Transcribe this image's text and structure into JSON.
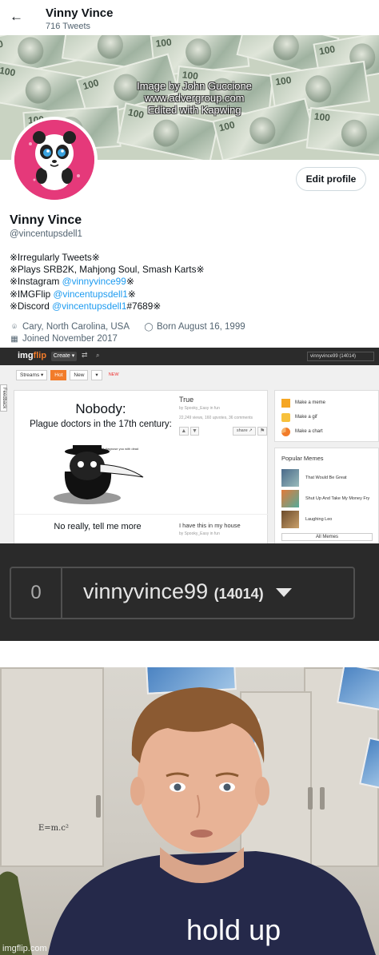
{
  "twitter": {
    "header_name": "Vinny Vince",
    "tweet_count": "716 Tweets",
    "banner_credit": [
      "Image by John Guccione",
      "www.advergroup.com",
      "Edited with Kapwing"
    ],
    "bill_denom": "100",
    "edit_profile_label": "Edit profile",
    "name": "Vinny Vince",
    "handle": "@vincentupsdell1",
    "bio": {
      "line1": "※Irregularly Tweets※",
      "line2": "※Plays SRB2K, Mahjong Soul, Smash Karts※",
      "line3_prefix": "※Instagram ",
      "line3_link": "@vinnyvince99",
      "line3_suffix": "※",
      "line4_prefix": "※IMGFlip ",
      "line4_link": "@vincentupsdell1",
      "line4_suffix": "※",
      "line5_prefix": "※Discord ",
      "line5_link": "@vincentupsdell1",
      "line5_suffix": "#7689※"
    },
    "location": "Cary, North Carolina, USA",
    "birthday": "Born August 16, 1999",
    "joined": "Joined November 2017",
    "icons": {
      "back": "arrow-left-icon",
      "location": "location-pin-icon",
      "birthday": "balloon-icon",
      "joined": "calendar-icon"
    }
  },
  "imgflip": {
    "logo_main": "img",
    "logo_accent": "flip",
    "create_label": "Create ▾",
    "user_label": "vinnyvince99 (14014)",
    "feedback": "Feedback",
    "tabs": [
      "Streams ▾",
      "Hot",
      "New",
      "▾"
    ],
    "new_tag": "NEW",
    "meme1": {
      "line1": "Nobody:",
      "line2": "Plague doctors in the 17th century:",
      "small_text": "I diagnose you with dead",
      "title": "True",
      "by": "by Spooky_Easy in fun",
      "stats": "22,249 views, 160 upvotes, 36 comments",
      "share_label": "share ↗"
    },
    "meme2": {
      "line1": "No really, tell me more",
      "title": "I have this in my house",
      "by": "by Spooky_Easy in fun"
    },
    "sidebar_actions": [
      "Make a meme",
      "Make a gif",
      "Make a chart"
    ],
    "popular_title": "Popular Memes",
    "popular": [
      "That Would Be Great",
      "Shut Up And Take My Money Fry",
      "Laughing Leo"
    ],
    "all_memes_label": "All Memes"
  },
  "zoom": {
    "count": "0",
    "username": "vinnyvince99",
    "points": "(14014)"
  },
  "photo": {
    "formula": "E=m.c²",
    "caption": "hold up",
    "watermark": "imgflip.com"
  },
  "colors": {
    "twitter_link": "#1d9bf0",
    "imgflip_orange": "#f27c2a",
    "avatar_pink": "#e5397a",
    "dark_bar": "#2a2a2a"
  }
}
